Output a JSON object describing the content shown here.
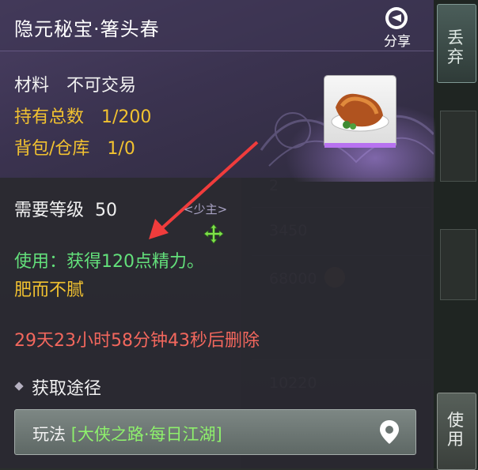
{
  "tooltip": {
    "title": "隐元秘宝·箸头春",
    "share_label": "分享",
    "material_label": "材料",
    "material_value": "不可交易",
    "owned_label": "持有总数",
    "owned_value": "1/200",
    "bag_label": "背包/仓库",
    "bag_value": "1/0",
    "level_label": "需要等级",
    "level_value": "50",
    "use_text": "使用：获得120点精力。",
    "flavor_text": "肥而不腻",
    "expiry_text": "29天23小时58分钟43秒后删除",
    "source_title": "获取途径",
    "source_prefix": "玩法 ",
    "source_link": "[大侠之路·每日江湖]",
    "rarity_color": "#b772f0"
  },
  "right_strip": {
    "discard_label": "丢弃",
    "use_label": "使用"
  },
  "background": {
    "nameplate": "<少主>",
    "list_values": [
      "2",
      "3450",
      "68000",
      "10220"
    ]
  },
  "icons": [
    "share-icon",
    "item-icon",
    "arrow-annotation",
    "move-cursor-icon",
    "diamond-icon",
    "location-pin-icon"
  ],
  "colors": {
    "gold": "#f2c230",
    "green": "#63e07b",
    "red": "#f2675d",
    "panel": "#2a2931"
  }
}
